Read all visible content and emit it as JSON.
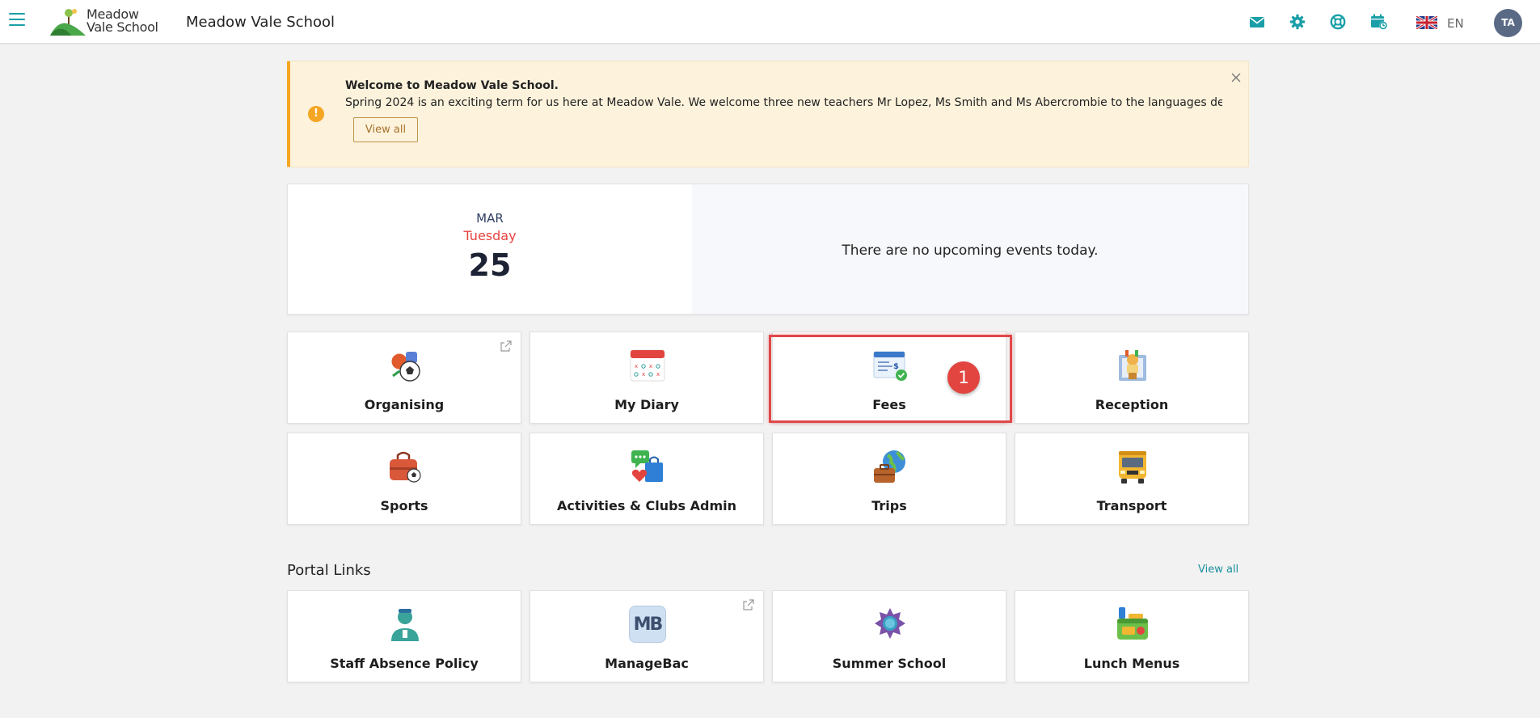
{
  "app": {
    "logo_line1": "Meadow",
    "logo_line2": "Vale School",
    "school_name": "Meadow Vale School",
    "language": "EN",
    "user_initials": "TA"
  },
  "header_icons": [
    "envelope-icon",
    "gear-icon",
    "lifebuoy-icon",
    "calendar-clock-icon",
    "uk-flag-icon"
  ],
  "banner": {
    "title": "Welcome to Meadow Vale School.",
    "text": "Spring 2024 is an exciting term for us here at Meadow Vale.  We welcome three new teachers Mr Lopez, Ms Smith and Ms Abercrombie to the languages department.  We",
    "button": "View all"
  },
  "date": {
    "month": "MAR",
    "weekday": "Tuesday",
    "day": "25",
    "events_text": "There are no upcoming events today."
  },
  "tiles": [
    {
      "label": "Organising",
      "icon": "sports-balls-icon",
      "external": true
    },
    {
      "label": "My Diary",
      "icon": "calendar-icon",
      "external": false
    },
    {
      "label": "Fees",
      "icon": "invoice-icon",
      "external": false
    },
    {
      "label": "Reception",
      "icon": "reception-desk-icon",
      "external": false
    },
    {
      "label": "Sports",
      "icon": "sports-bag-icon",
      "external": false
    },
    {
      "label": "Activities & Clubs Admin",
      "icon": "chat-bag-icon",
      "external": false
    },
    {
      "label": "Trips",
      "icon": "globe-suitcase-icon",
      "external": false
    },
    {
      "label": "Transport",
      "icon": "school-bus-icon",
      "external": false
    }
  ],
  "annotation": {
    "step": "1"
  },
  "portal": {
    "title": "Portal Links",
    "view_all": "View all",
    "links": [
      {
        "label": "Staff Absence Policy",
        "icon": "staff-person-icon",
        "external": false
      },
      {
        "label": "ManageBac",
        "icon": "managebac-icon",
        "icon_text": "MB",
        "external": true
      },
      {
        "label": "Summer School",
        "icon": "sun-badge-icon",
        "external": false
      },
      {
        "label": "Lunch Menus",
        "icon": "lunchbox-icon",
        "external": false
      }
    ]
  },
  "colors": {
    "accent": "#1a9fa8",
    "banner_bg": "#fdf3dc",
    "banner_border": "#f5a623",
    "weekday": "#e8423f",
    "highlight": "#e0484a"
  }
}
